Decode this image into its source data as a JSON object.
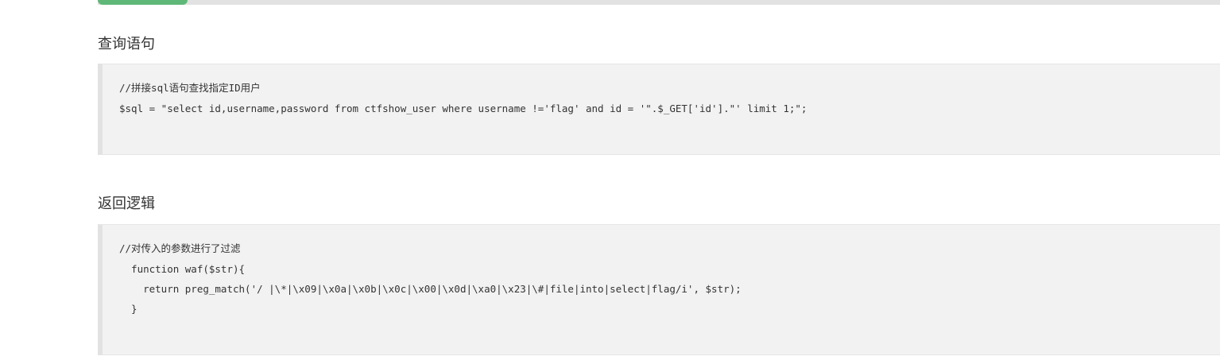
{
  "progress": {
    "label": "",
    "percent": 8
  },
  "sections": [
    {
      "title": "查询语句",
      "code_lines": [
        "//拼接sql语句查找指定ID用户",
        "$sql = \"select id,username,password from ctfshow_user where username !='flag' and id = '\".$_GET['id'].\"' limit 1;\";"
      ]
    },
    {
      "title": "返回逻辑",
      "code_lines": [
        "//对传入的参数进行了过滤",
        "  function waf($str){",
        "    return preg_match('/ |\\*|\\x09|\\x0a|\\x0b|\\x0c|\\x00|\\x0d|\\xa0|\\x23|\\#|file|into|select|flag/i', $str);",
        "  }"
      ]
    }
  ],
  "colors": {
    "progress_fill": "#5fb878",
    "progress_track": "#e2e2e2",
    "code_bg": "#f2f2f2",
    "code_border": "#e2e2e2"
  }
}
